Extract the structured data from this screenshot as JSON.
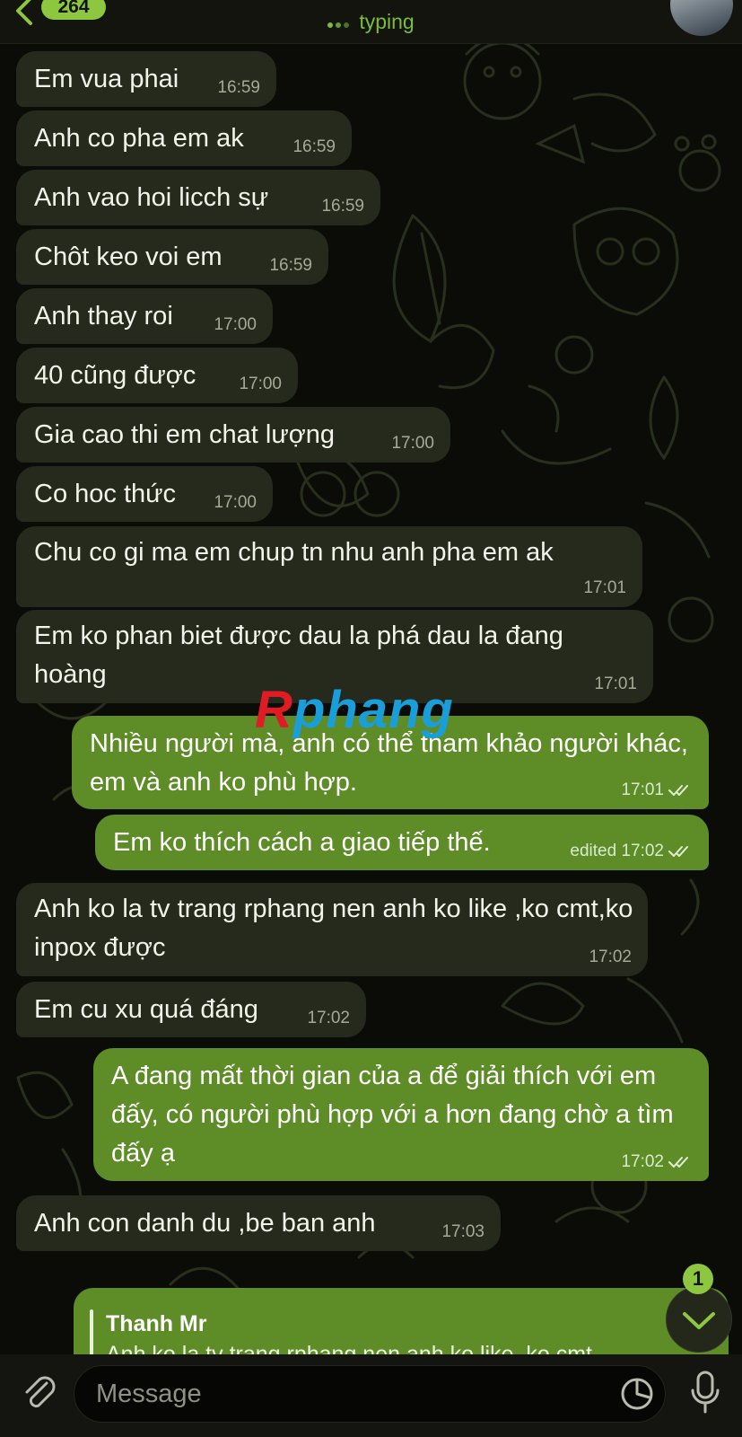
{
  "header": {
    "back_badge": "264",
    "title": "",
    "status": "typing"
  },
  "messages": [
    {
      "dir": "in",
      "text": "Em vua phai",
      "time": "16:59"
    },
    {
      "dir": "in",
      "text": "Anh co pha em ak",
      "time": "16:59"
    },
    {
      "dir": "in",
      "text": "Anh vao hoi licch sự",
      "time": "16:59"
    },
    {
      "dir": "in",
      "text": "Chôt keo voi em",
      "time": "16:59"
    },
    {
      "dir": "in",
      "text": "Anh thay roi",
      "time": "17:00"
    },
    {
      "dir": "in",
      "text": "40 cũng được",
      "time": "17:00"
    },
    {
      "dir": "in",
      "text": "Gia cao thi em chat lượng",
      "time": "17:00"
    },
    {
      "dir": "in",
      "text": "Co hoc thức",
      "time": "17:00"
    },
    {
      "dir": "in",
      "text": "Chu co gi ma em chup tn nhu anh pha em ak",
      "time": "17:01"
    },
    {
      "dir": "in",
      "text": "Em ko phan biet được dau la phá dau la đang hoàng",
      "time": "17:01"
    },
    {
      "dir": "out",
      "text": "Nhiều người mà, anh có thể tham khảo người khác, em và anh ko phù hợp.",
      "time": "17:01"
    },
    {
      "dir": "out",
      "text": "Em ko thích cách a giao tiếp thế.",
      "time": "edited 17:02"
    },
    {
      "dir": "in",
      "text": "Anh ko la tv trang rphang nen anh ko like ,ko cmt,ko inpox được",
      "time": "17:02"
    },
    {
      "dir": "in",
      "text": "Em cu xu quá đáng",
      "time": "17:02"
    },
    {
      "dir": "out",
      "text": "A đang mất thời gian của a để giải thích với em đấy, có người phù hợp với a hơn đang chờ a tìm đấy ạ",
      "time": "17:02"
    },
    {
      "dir": "in",
      "text": "Anh con danh du ,be ban anh",
      "time": "17:03"
    }
  ],
  "watermark": {
    "r": "R",
    "rest": "phang"
  },
  "reply_preview": {
    "author": "Thanh Mr",
    "snippet": "Anh ko la tv trang rphang nen anh ko like ,ko cmt"
  },
  "scroll_button": {
    "unread": "1"
  },
  "composer": {
    "placeholder": "Message"
  },
  "icons": {
    "back": "chevron-left-icon",
    "attach": "paperclip-icon",
    "sticker": "sticker-icon",
    "mic": "microphone-icon",
    "scroll": "chevron-down-icon"
  },
  "colors": {
    "accent": "#8dc63f",
    "incoming_bubble": "#262a1d",
    "outgoing_bubble": "#5e8c27",
    "background": "#0b0c08"
  }
}
